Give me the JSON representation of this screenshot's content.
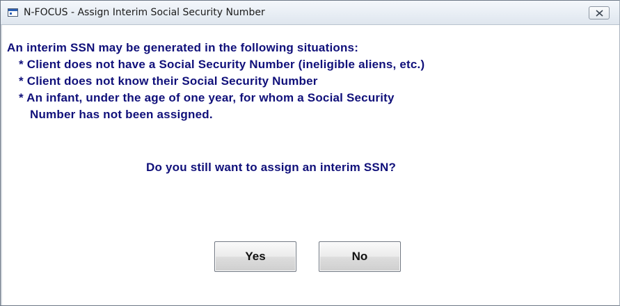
{
  "window": {
    "title": "N-FOCUS - Assign Interim Social Security Number",
    "app_icon": "window-app-icon",
    "close_icon": "close-icon"
  },
  "message": {
    "intro": "An interim SSN may be generated in the following situations:",
    "bullets": [
      "* Client does not have a Social Security Number (ineligible aliens, etc.)",
      "* Client does not know their Social Security Number",
      "* An infant, under the age of one year, for whom a Social Security",
      "Number has not been assigned."
    ],
    "question": "Do you still want to assign an interim SSN?"
  },
  "buttons": {
    "yes": "Yes",
    "no": "No"
  },
  "colors": {
    "message_text": "#10107a",
    "title_bar": "#e7edf4",
    "background": "#ffffff"
  }
}
